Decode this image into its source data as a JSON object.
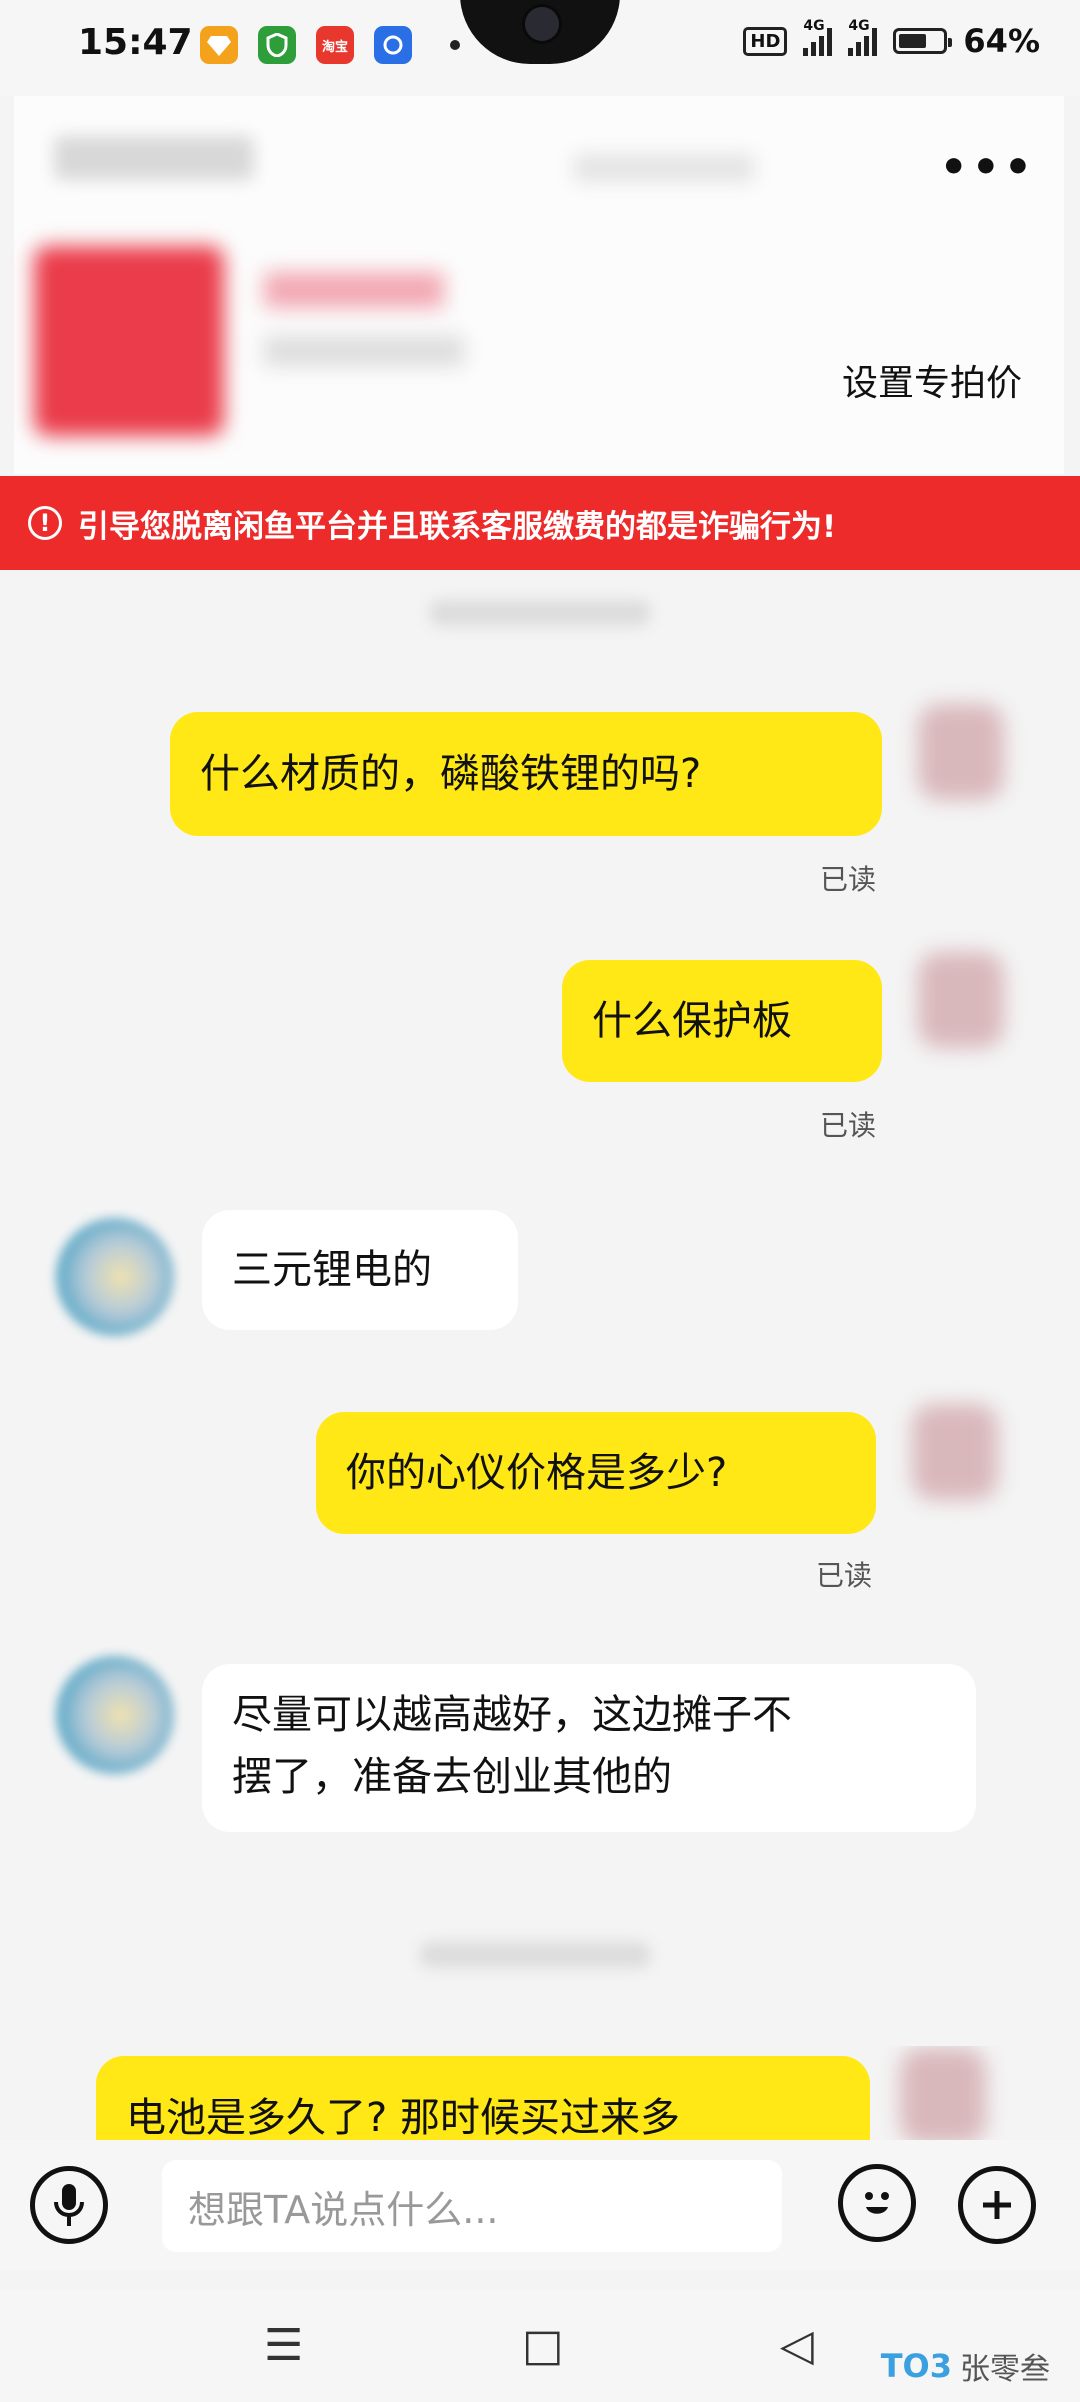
{
  "status_bar": {
    "time": "15:47",
    "apps": [
      {
        "icon": "diamond-app-icon",
        "color": "#f4a21b"
      },
      {
        "icon": "shield-app-icon",
        "color": "#2e9e3a"
      },
      {
        "icon": "taobao-app-icon",
        "color": "#e8372c",
        "label": "淘宝"
      },
      {
        "icon": "qq-browser-app-icon",
        "color": "#2a6fe6"
      }
    ],
    "hd": "HD",
    "network_1": "4G",
    "network_2": "4G",
    "battery_level": 0.64,
    "battery_percent": "64%"
  },
  "header": {
    "more_icon": "more-dots-icon",
    "set_price_label": "设置专拍价"
  },
  "warning": {
    "icon": "alert-circle-icon",
    "text": "引导您脱离闲鱼平台并且联系客服缴费的都是诈骗行为!"
  },
  "messages": [
    {
      "side": "out",
      "text": "什么材质的，磷酸铁锂的吗?",
      "status": "已读"
    },
    {
      "side": "out",
      "text": "什么保护板",
      "status": "已读"
    },
    {
      "side": "in",
      "text": "三元锂电的"
    },
    {
      "side": "out",
      "text": "你的心仪价格是多少?",
      "status": "已读"
    },
    {
      "side": "in",
      "text_line1": "尽量可以越高越好，这边摊子不",
      "text_line2": "摆了，准备去创业其他的"
    },
    {
      "side": "out",
      "text": "电池是多久了? 那时候买过来多"
    }
  ],
  "input_bar": {
    "voice_icon": "microphone-icon",
    "placeholder": "想跟TA说点什么...",
    "emoji_icon": "emoji-icon",
    "add_icon": "plus-icon"
  },
  "nav_bar": {
    "menu_icon": "menu-icon",
    "home_icon": "home-square-icon",
    "back_icon": "back-triangle-icon",
    "menu_glyph": "☰",
    "home_glyph": "□",
    "back_glyph": "◁"
  },
  "watermark": {
    "logo": "TO3",
    "text": "张零叁"
  }
}
